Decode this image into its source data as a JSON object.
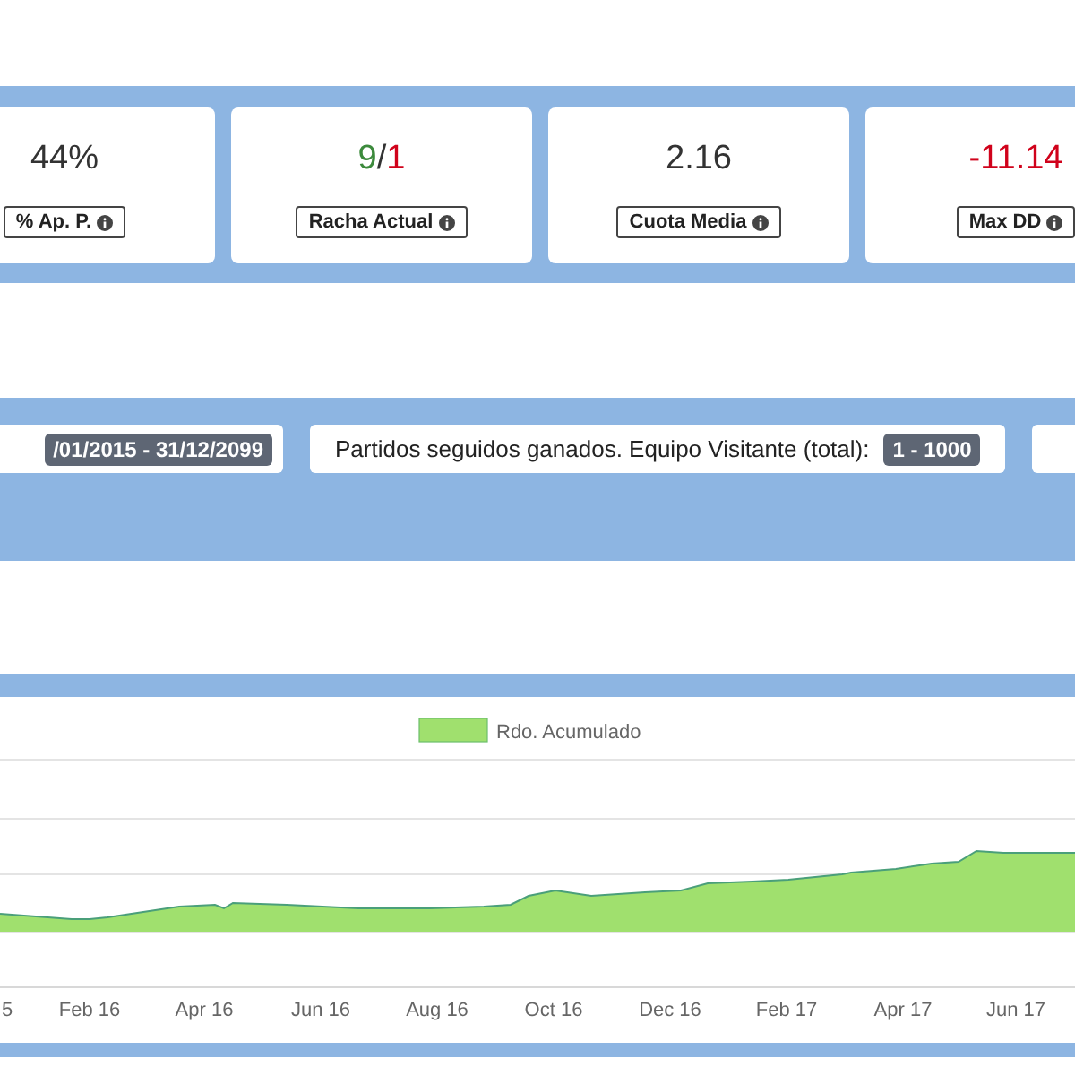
{
  "stats": [
    {
      "value_parts": [
        {
          "text": "44%",
          "color": "#333333"
        }
      ],
      "label": "% Ap. P."
    },
    {
      "value_parts": [
        {
          "text": "9",
          "color": "#3c8a3c"
        },
        {
          "text": "/",
          "color": "#333333"
        },
        {
          "text": "1",
          "color": "#d0021b"
        }
      ],
      "label": "Racha Actual"
    },
    {
      "value_parts": [
        {
          "text": "2.16",
          "color": "#333333"
        }
      ],
      "label": "Cuota Media"
    },
    {
      "value_parts": [
        {
          "text": "-11.14",
          "color": "#d0021b"
        }
      ],
      "label": "Max DD"
    }
  ],
  "filters": [
    {
      "badge": "/01/2015 - 31/12/2099"
    },
    {
      "label": "Partidos seguidos ganados. Equipo Visitante (total):",
      "badge": "1 - 1000"
    }
  ],
  "chart": {
    "legend": "Rdo. Acumulado",
    "x_labels": [
      "5",
      "Feb 16",
      "Apr 16",
      "Jun 16",
      "Aug 16",
      "Oct 16",
      "Dec 16",
      "Feb 17",
      "Apr 17",
      "Jun 17"
    ]
  }
}
